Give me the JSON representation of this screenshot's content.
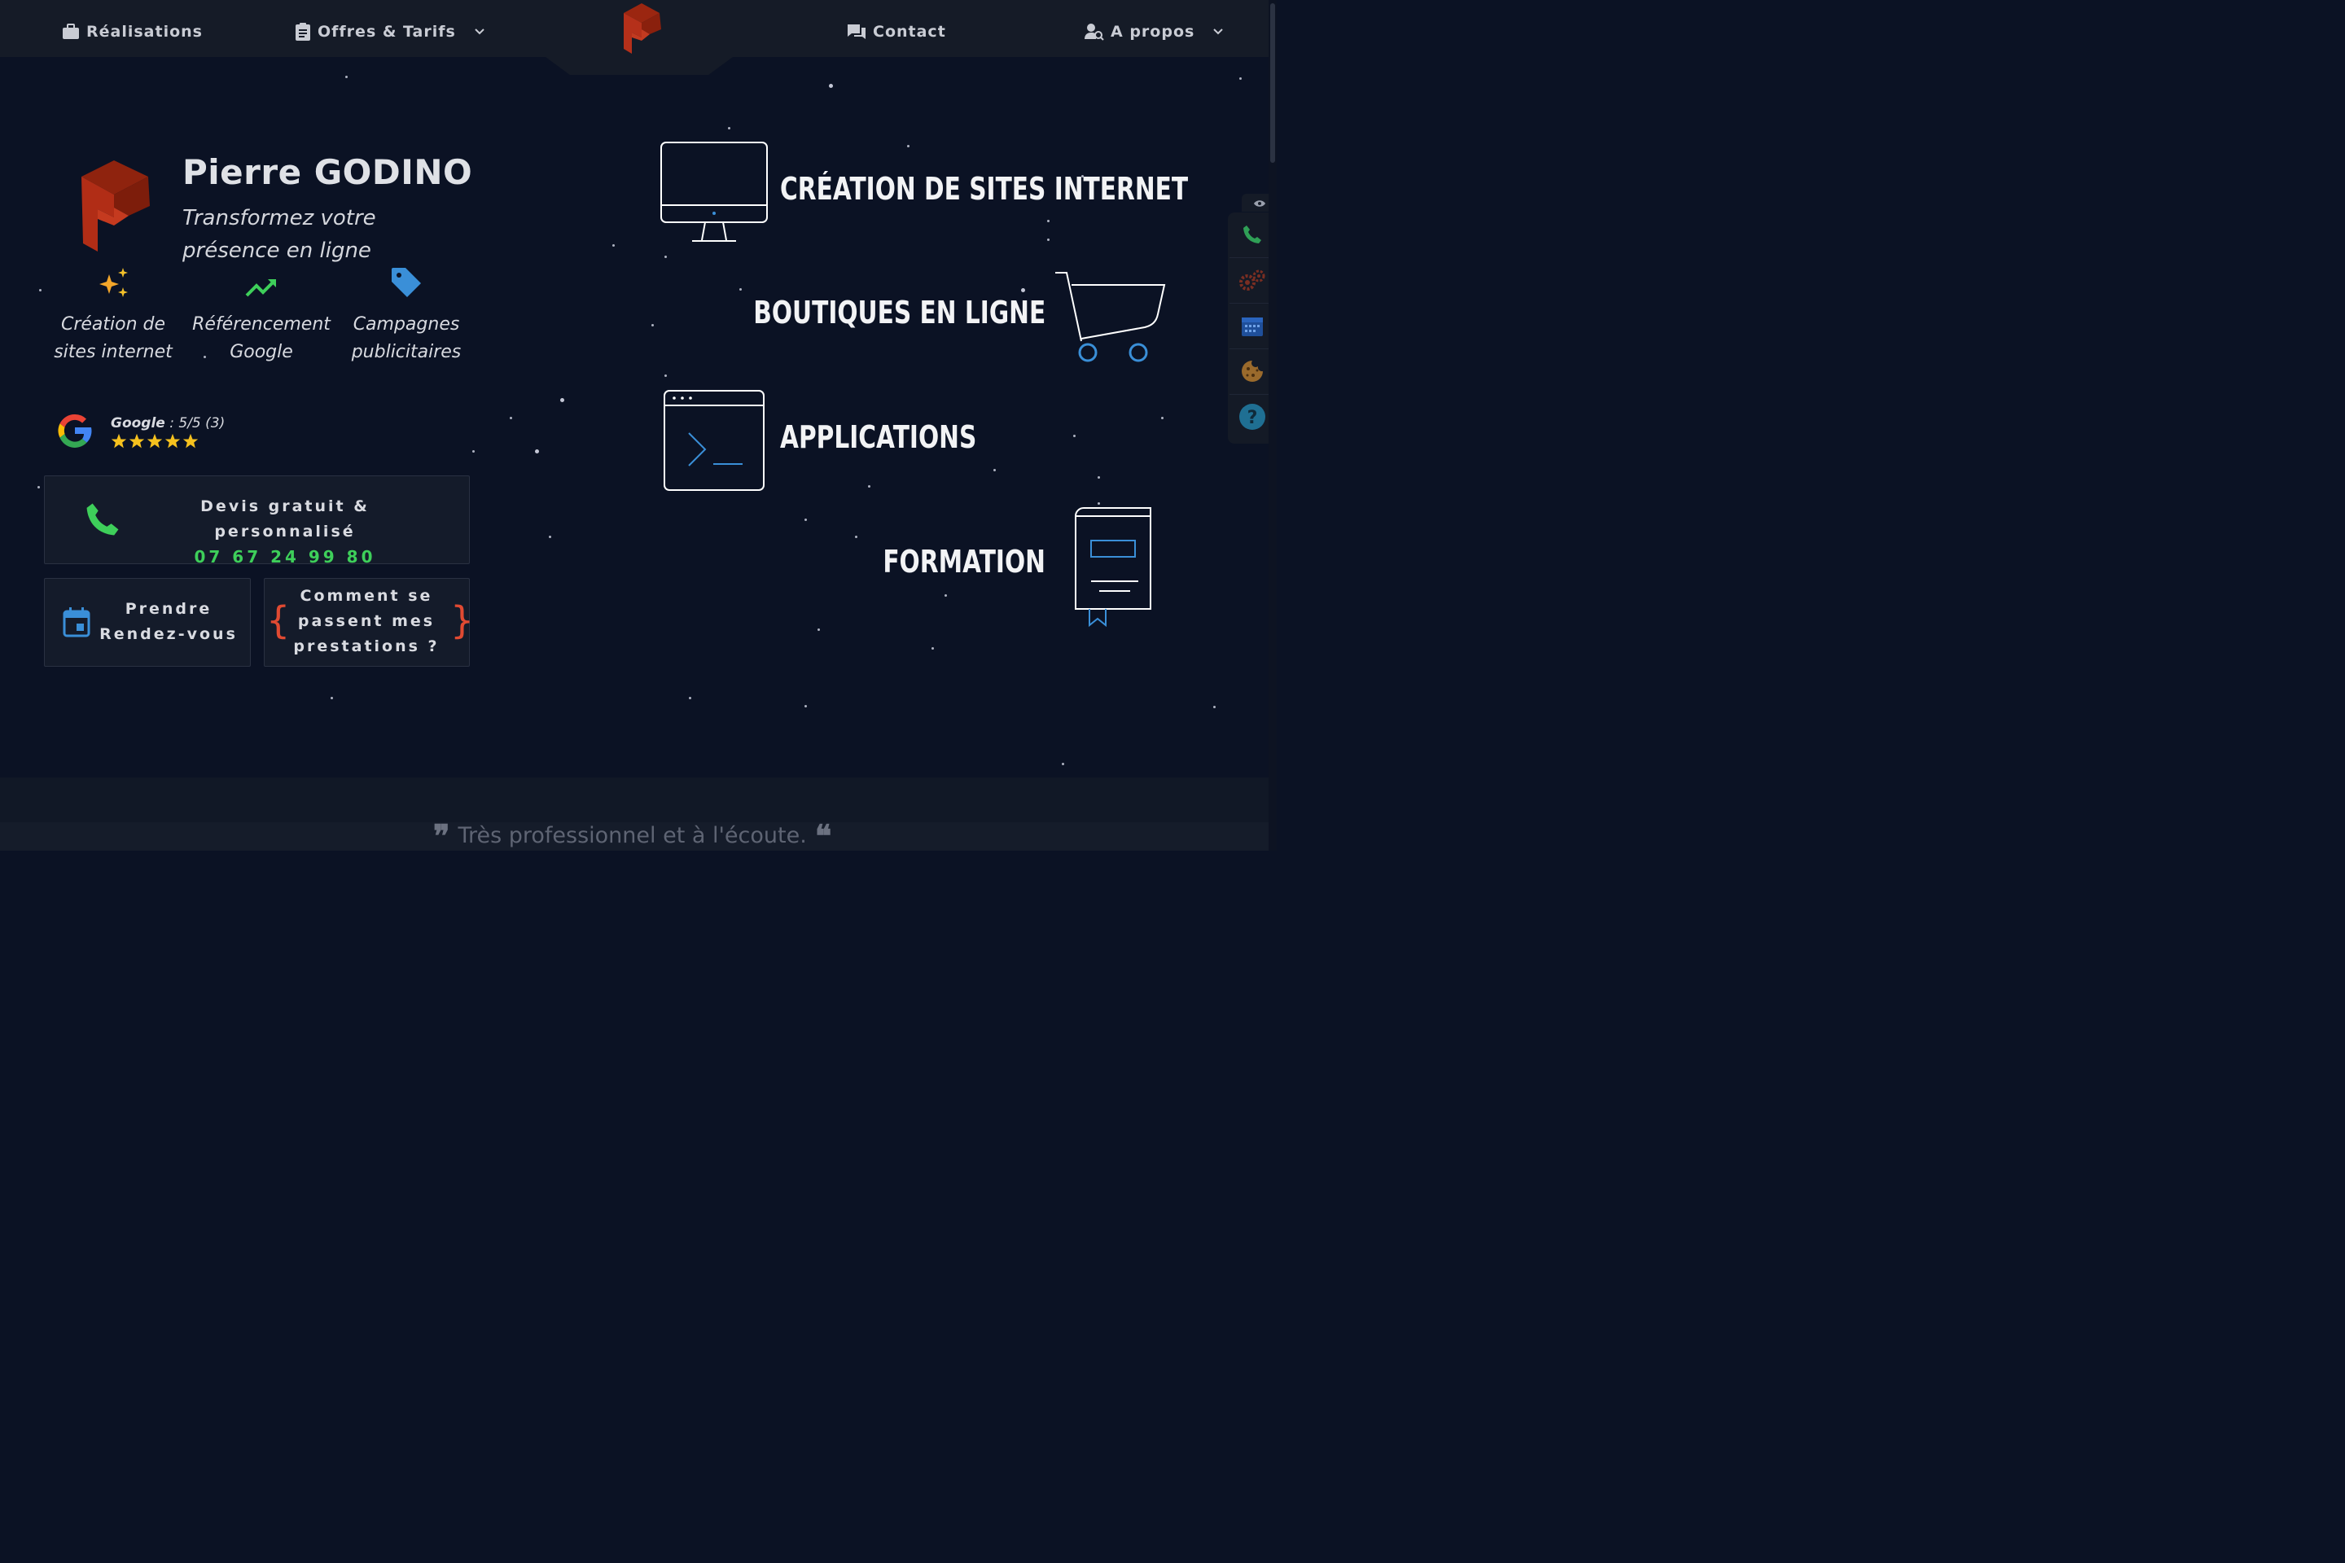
{
  "nav": {
    "items": [
      {
        "label": "Réalisations"
      },
      {
        "label": "Offres & Tarifs"
      },
      {
        "label": "Contact"
      },
      {
        "label": "A propos"
      }
    ]
  },
  "hero": {
    "name": "Pierre GODINO",
    "tagline": "Transformez votre présence en ligne",
    "services": [
      {
        "label": "Création de sites internet",
        "icon": "sparkles-icon"
      },
      {
        "label": "Référencement Google",
        "icon": "trending-up-icon"
      },
      {
        "label": "Campagnes publicitaires",
        "icon": "tag-icon"
      }
    ],
    "google": {
      "label": "Google",
      "score": " : 5/5 (3)"
    },
    "quote_card": {
      "line1": "Devis gratuit & personnalisé",
      "phone": "07 67 24 99 80"
    },
    "appointment": {
      "label": "Prendre Rendez-vous"
    },
    "process": {
      "label": "Comment se passent mes prestations ?"
    }
  },
  "offers": [
    {
      "title": "CRÉATION DE SITES INTERNET"
    },
    {
      "title": "BOUTIQUES EN LIGNE"
    },
    {
      "title": "APPLICATIONS"
    },
    {
      "title": "FORMATION"
    }
  ],
  "testimonial": {
    "text": "Très professionnel et à l'écoute."
  },
  "colors": {
    "accent_green": "#3ecf5a",
    "logo_red": "#a8260f",
    "icon_blue": "#3a8fd8",
    "bg": "#0b1224"
  }
}
